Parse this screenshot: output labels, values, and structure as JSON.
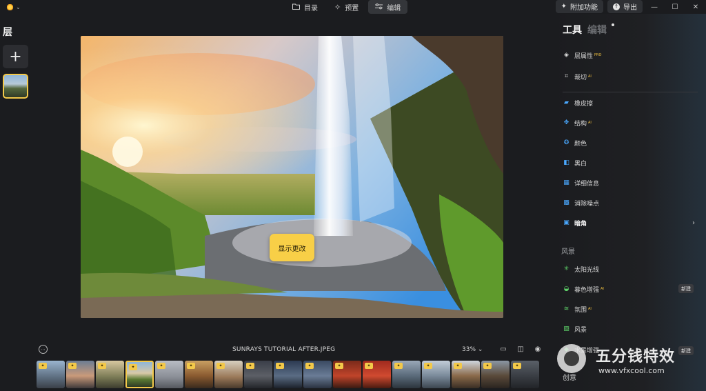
{
  "window": {
    "logo_icon": "sun-icon",
    "mode_tabs": [
      {
        "label": "目录",
        "icon": "folder-icon"
      },
      {
        "label": "预置",
        "icon": "sparkle-icon"
      },
      {
        "label": "编辑",
        "icon": "sliders-icon",
        "active": true
      }
    ],
    "addons_label": "附加功能",
    "export_label": "导出",
    "controls": {
      "minimize": "—",
      "maximize": "☐",
      "close": "✕"
    }
  },
  "layers": {
    "title": "层",
    "add_symbol": "+"
  },
  "canvas": {
    "show_changes_label": "显示更改"
  },
  "tools": {
    "tabs": [
      {
        "label": "工具",
        "active": true
      },
      {
        "label": "编辑",
        "active": false
      }
    ],
    "items_top": [
      {
        "label": "层属性",
        "sup": "PRO"
      },
      {
        "label": "裁切",
        "sup": "AI"
      }
    ],
    "items": [
      {
        "label": "橡皮擦",
        "sup": ""
      },
      {
        "label": "结构",
        "sup": "AI"
      },
      {
        "label": "颜色",
        "sup": ""
      },
      {
        "label": "黑白",
        "sup": ""
      },
      {
        "label": "详细信息",
        "sup": ""
      },
      {
        "label": "消除噪点",
        "sup": ""
      },
      {
        "label": "暗角",
        "sup": ""
      }
    ],
    "section_landscape": "风景",
    "landscape_items": [
      {
        "label": "太阳光线",
        "sup": ""
      },
      {
        "label": "暮色增强",
        "sup": "AI"
      },
      {
        "label": "氛围",
        "sup": "AI"
      },
      {
        "label": "风景",
        "sup": ""
      },
      {
        "label": "水景增强",
        "sup": ""
      }
    ],
    "new_badge": "新建",
    "section_creative": "创意"
  },
  "bottom": {
    "more_symbol": "⋯",
    "filename": "SUNRAYS TUTORIAL AFTER.JPEG",
    "zoom": "33% ⌄"
  },
  "watermark": {
    "title": "五分钱特效",
    "url": "www.vfxcool.com"
  }
}
